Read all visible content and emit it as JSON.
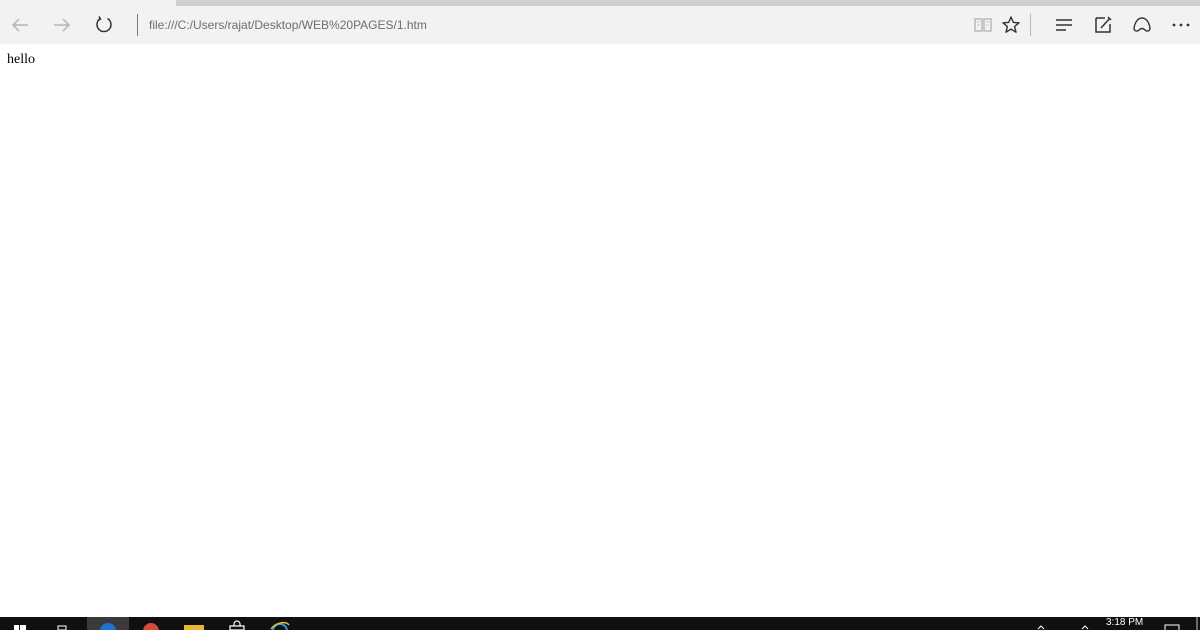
{
  "browser": {
    "address_url": "file:///C:/Users/rajat/Desktop/WEB%20PAGES/1.htm",
    "nav_icons": [
      "back-arrow-icon",
      "forward-arrow-icon",
      "refresh-icon"
    ],
    "toolbar_icons": [
      "reading-view-icon",
      "favorite-star-icon",
      "hub-icon",
      "web-note-icon",
      "share-icon",
      "more-icon"
    ]
  },
  "page": {
    "text": "hello"
  },
  "taskbar": {
    "time": "3:18 PM",
    "icons": [
      "start-icon",
      "task-view-icon",
      "edge-icon",
      "chrome-icon",
      "file-explorer-icon",
      "store-icon",
      "internet-explorer-icon",
      "action-center-icon"
    ]
  },
  "colors": {
    "chrome_bg": "#f2f2f2",
    "taskbar_bg": "#101010",
    "address_text": "#6d6d6d",
    "edge_blue": "#1e73d2"
  }
}
